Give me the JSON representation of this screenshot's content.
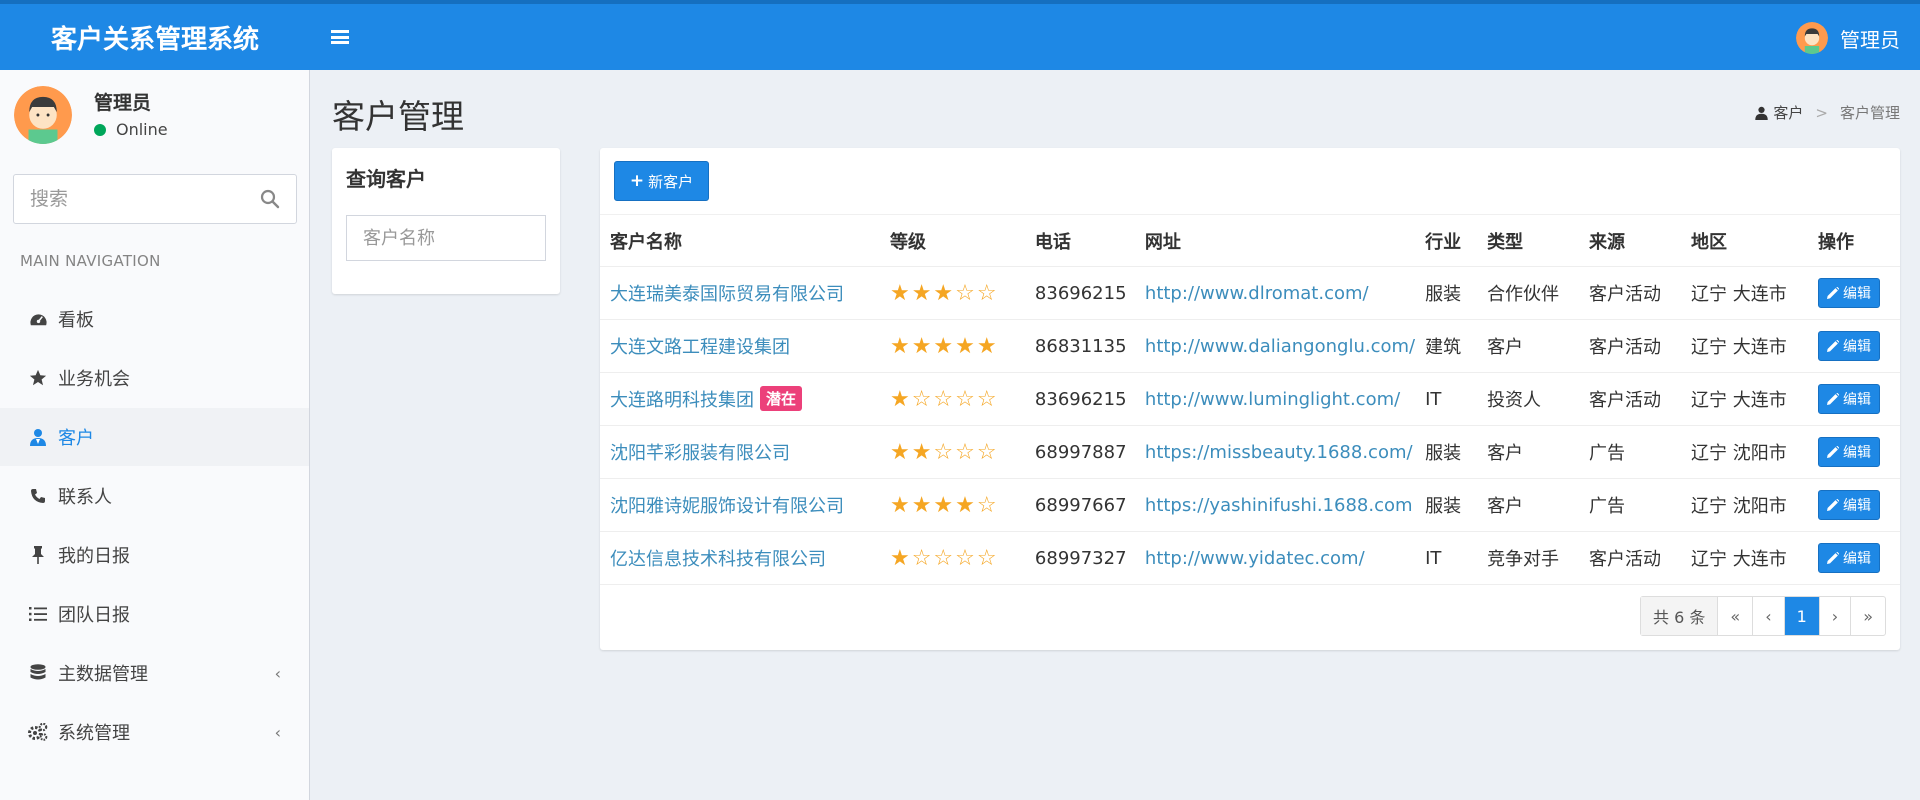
{
  "app": {
    "title": "客户关系管理系统",
    "user": "管理员"
  },
  "sidebar": {
    "user_name": "管理员",
    "user_status": "Online",
    "search_placeholder": "搜索",
    "nav_header": "MAIN NAVIGATION",
    "items": [
      {
        "label": "看板",
        "icon": "dashboard-icon"
      },
      {
        "label": "业务机会",
        "icon": "star-icon"
      },
      {
        "label": "客户",
        "icon": "user-icon",
        "active": true
      },
      {
        "label": "联系人",
        "icon": "phone-icon"
      },
      {
        "label": "我的日报",
        "icon": "pin-icon"
      },
      {
        "label": "团队日报",
        "icon": "list-icon"
      },
      {
        "label": "主数据管理",
        "icon": "database-icon",
        "expandable": true
      },
      {
        "label": "系统管理",
        "icon": "cogs-icon",
        "expandable": true
      }
    ]
  },
  "page": {
    "title": "客户管理",
    "breadcrumb": [
      "客户",
      "客户管理"
    ]
  },
  "query": {
    "title": "查询客户",
    "name_placeholder": "客户名称"
  },
  "list": {
    "new_button": "新客户",
    "columns": [
      "客户名称",
      "等级",
      "电话",
      "网址",
      "行业",
      "类型",
      "来源",
      "地区",
      "操作"
    ],
    "edit_label": "编辑",
    "rows": [
      {
        "name": "大连瑞美泰国际贸易有限公司",
        "tag": "",
        "stars": 3,
        "phone": "83696215",
        "url": "http://www.dlromat.com/",
        "industry": "服装",
        "type": "合作伙伴",
        "source": "客户活动",
        "region": "辽宁 大连市"
      },
      {
        "name": "大连文路工程建设集团",
        "tag": "",
        "stars": 5,
        "phone": "86831135",
        "url": "http://www.daliangonglu.com/",
        "industry": "建筑",
        "type": "客户",
        "source": "客户活动",
        "region": "辽宁 大连市"
      },
      {
        "name": "大连路明科技集团",
        "tag": "潜在",
        "stars": 1,
        "phone": "83696215",
        "url": "http://www.luminglight.com/",
        "industry": "IT",
        "type": "投资人",
        "source": "客户活动",
        "region": "辽宁 大连市"
      },
      {
        "name": "沈阳芊彩服装有限公司",
        "tag": "",
        "stars": 2,
        "phone": "68997887",
        "url": "https://missbeauty.1688.com/",
        "industry": "服装",
        "type": "客户",
        "source": "广告",
        "region": "辽宁 沈阳市"
      },
      {
        "name": "沈阳雅诗妮服饰设计有限公司",
        "tag": "",
        "stars": 4,
        "phone": "68997667",
        "url": "https://yashinifushi.1688.com",
        "industry": "服装",
        "type": "客户",
        "source": "广告",
        "region": "辽宁 沈阳市"
      },
      {
        "name": "亿达信息技术科技有限公司",
        "tag": "",
        "stars": 1,
        "phone": "68997327",
        "url": "http://www.yidatec.com/",
        "industry": "IT",
        "type": "竞争对手",
        "source": "客户活动",
        "region": "辽宁 大连市"
      }
    ],
    "pagination": {
      "total": "共 6 条",
      "first": "«",
      "prev": "‹",
      "current": "1",
      "next": "›",
      "last": "»"
    }
  },
  "colors": {
    "primary": "#1e88e5",
    "star": "#f5a623",
    "tag": "#ec407a",
    "link": "#3c8dbc"
  }
}
